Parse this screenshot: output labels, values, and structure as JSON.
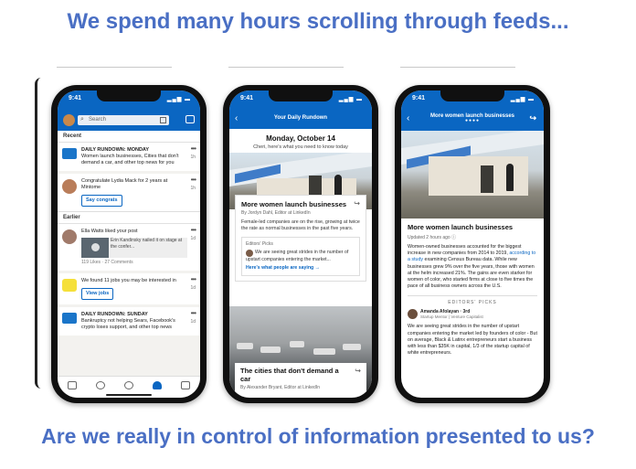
{
  "headline_top": "We spend many hours scrolling through feeds...",
  "headline_bottom": "Are we really in control of information presented to us?",
  "colors": {
    "accent": "#4a6fc4",
    "linkedin_blue": "#0a66c2"
  },
  "phone1": {
    "time": "9:41",
    "search_placeholder": "Search",
    "recent_label": "Recent",
    "earlier_label": "Earlier",
    "notifications": [
      {
        "title": "DAILY RUNDOWN: MONDAY",
        "text": "Women launch businesses, Cities that don't demand a car, and other top news for you",
        "time": "1h",
        "icon": "newspaper-icon"
      },
      {
        "text": "Congratulate Lydia Mack for 2 years at Mintome",
        "time": "1h",
        "button": "Say congrats",
        "icon": "person-avatar-icon"
      },
      {
        "text": "Ella Watts liked your post",
        "time": "1d",
        "media_text": "Erin Kandinsky nailed it on stage at the confer...",
        "meta": "119 Likes · 27 Comments",
        "icon": "person-avatar-icon"
      },
      {
        "text": "We found 11 jobs you may be interested in",
        "time": "1d",
        "button": "View jobs",
        "icon": "jobs-icon"
      },
      {
        "title": "DAILY RUNDOWN: SUNDAY",
        "text": "Bankruptcy not helping Sears, Facebook's crypto loses support, and other top news",
        "time": "1d",
        "icon": "newspaper-icon"
      }
    ]
  },
  "phone2": {
    "time": "9:41",
    "header": "Your Daily Rundown",
    "date": "Monday, October 14",
    "subtitle": "Cheri, here's what you need to know today",
    "article1": {
      "title": "More women launch businesses",
      "byline": "By Jordyn Dahl, Editor at LinkedIn",
      "body": "Female-led companies are on the rise, growing at twice the rate as normal businesses in the past five years.",
      "picks_label": "Editors' Picks",
      "pick_text": "We are seeing great strides in the number of upstart companies entering the market...",
      "link": "Here's what people are saying →"
    },
    "article2": {
      "title": "The cities that don't demand a car",
      "byline": "By Alexander Bryant, Editor at LinkedIn"
    }
  },
  "phone3": {
    "time": "9:41",
    "header": "More women launch businesses",
    "title": "More women launch businesses",
    "updated": "Updated 2 hours ago ⓘ",
    "body_before_link": "Women-owned businesses accounted for the biggest increase in new companies from 2014 to 2019, ",
    "body_link": "according to a study",
    "body_after_link": " examining Census Bureau data. While new businesses grew 9% over the five years, those with women at the helm increased 21%. The gains are even starker for women of color, who started firms at close to five times the pace of all business owners across the U.S.",
    "editors_picks": "EDITORS' PICKS",
    "author_name": "Amanda Afolayan · 3rd",
    "author_role": "Startup Mentor | Venture Capitalist",
    "quote": "We are seeing great strides in the number of upstart companies entering the market led by founders of color - But on average, Black & Latinx entrepreneurs start a business with less than $35K in capital, 1/3 of the startup capital of white entrepreneurs."
  }
}
